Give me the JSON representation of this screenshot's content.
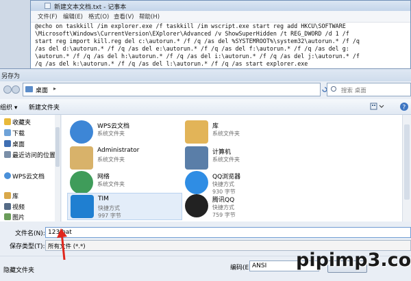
{
  "notepad": {
    "title": "新建文本文档.txt - 记事本",
    "menu": [
      "文件(F)",
      "编辑(E)",
      "格式(O)",
      "查看(V)",
      "帮助(H)"
    ],
    "lines": [
      "@echo on taskkill /im explorer.exe /f taskkill /im wscript.exe start reg add HKCU\\SOFTWARE",
      "\\Microsoft\\Windows\\CurrentVersion\\EXplorer\\Advanced /v ShowSuperHidden /t REG_DWORD /d 1 /f",
      "start reg import kill.reg del c:\\autorun.* /f /q /as del %SYSTEMROOT%\\system32\\autorun.* /f /q",
      "/as del d:\\autorun.* /f /q /as del e:\\autorun.* /f /q /as del f:\\autorun.* /f /q /as del g:",
      "\\autorun.* /f /q /as del h:\\autorun.* /f /q /as del i:\\autorun.* /f /q /as del j:\\autorun.* /f",
      "/q /as del k:\\autorun.* /f /q /as del l:\\autorun.* /f /q /as start explorer.exe"
    ]
  },
  "dialog": {
    "title": "另存为",
    "address": "桌面",
    "search_placeholder": "搜索 桌面",
    "toolbar": {
      "organize": "组织 ▾",
      "new_folder": "新建文件夹"
    },
    "nav": [
      {
        "label": "收藏夹",
        "icon": "star-icon",
        "color": "#e8b93a"
      },
      {
        "label": "下载",
        "icon": "download-folder-icon",
        "color": "#6fa3d8"
      },
      {
        "label": "桌面",
        "icon": "desktop-icon",
        "color": "#3f6fb3"
      },
      {
        "label": "最近访问的位置",
        "icon": "recent-places-icon",
        "color": "#7a8fa8"
      },
      {
        "label": "WPS云文档",
        "icon": "cloud-icon",
        "color": "#4a90d9"
      },
      {
        "label": "库",
        "icon": "library-icon",
        "color": "#d9a84a"
      },
      {
        "label": "视频",
        "icon": "video-icon",
        "color": "#556b86"
      },
      {
        "label": "图片",
        "icon": "picture-icon",
        "color": "#6b9d5a"
      }
    ],
    "files": [
      {
        "name": "WPS云文档",
        "sub1": "系统文件夹",
        "sub2": "",
        "icon": "wps-cloud-icon",
        "color": "#3d86d6"
      },
      {
        "name": "库",
        "sub1": "系统文件夹",
        "sub2": "",
        "icon": "library-folder-icon",
        "color": "#e2b458"
      },
      {
        "name": "Administrator",
        "sub1": "系统文件夹",
        "sub2": "",
        "icon": "user-folder-icon",
        "color": "#d8b26a"
      },
      {
        "name": "计算机",
        "sub1": "系统文件夹",
        "sub2": "",
        "icon": "computer-icon",
        "color": "#5a7ea8"
      },
      {
        "name": "网络",
        "sub1": "系统文件夹",
        "sub2": "",
        "icon": "network-globe-icon",
        "color": "#3f9c5a"
      },
      {
        "name": "QQ浏览器",
        "sub1": "快捷方式",
        "sub2": "930 字节",
        "icon": "qq-browser-icon",
        "color": "#2f8de4"
      },
      {
        "name": "TIM",
        "sub1": "快捷方式",
        "sub2": "997 字节",
        "icon": "tim-icon",
        "color": "#1f7fd1"
      },
      {
        "name": "腾讯QQ",
        "sub1": "快捷方式",
        "sub2": "759 字节",
        "icon": "qq-penguin-icon",
        "color": "#222222"
      }
    ],
    "filename_label": "文件名(N):",
    "filename_value": "123.bat",
    "filetype_label": "保存类型(T):",
    "filetype_value": "所有文件 (*.*)",
    "hide_folders": "隐藏文件夹",
    "encoding_label": "编码(E):",
    "encoding_value": "ANSI"
  },
  "watermark": "pipimp3.com",
  "colors": {
    "accent": "#3d86d6",
    "annotation_arrow": "#e0261c"
  }
}
